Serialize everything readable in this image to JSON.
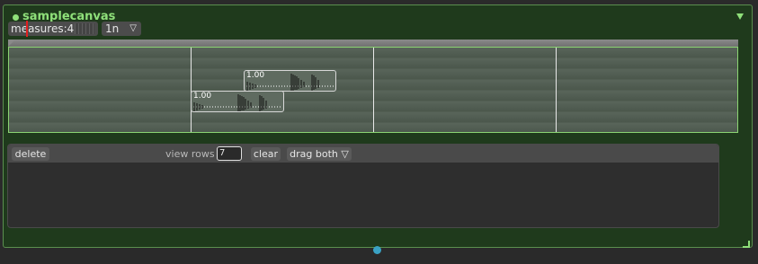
{
  "object": {
    "title": "samplecanvas",
    "colors": {
      "accent": "#8fe07a",
      "panel_bg": "#1f3a1c",
      "outlet": "#3aa2c4"
    },
    "icons": {
      "collapse": "triangle-down-icon",
      "resize": "resize-corner-icon",
      "status": "status-dot-icon"
    }
  },
  "toolbar": {
    "measures_label": "measures:4",
    "note_value": "1n",
    "note_arrow": "▽"
  },
  "canvas": {
    "clips": [
      {
        "label": "1.00"
      },
      {
        "label": "1.00"
      }
    ]
  },
  "editor": {
    "delete_label": "delete",
    "view_rows_label": "view rows",
    "view_rows_value": "7",
    "clear_label": "clear",
    "drag_label": "drag both ▽"
  }
}
